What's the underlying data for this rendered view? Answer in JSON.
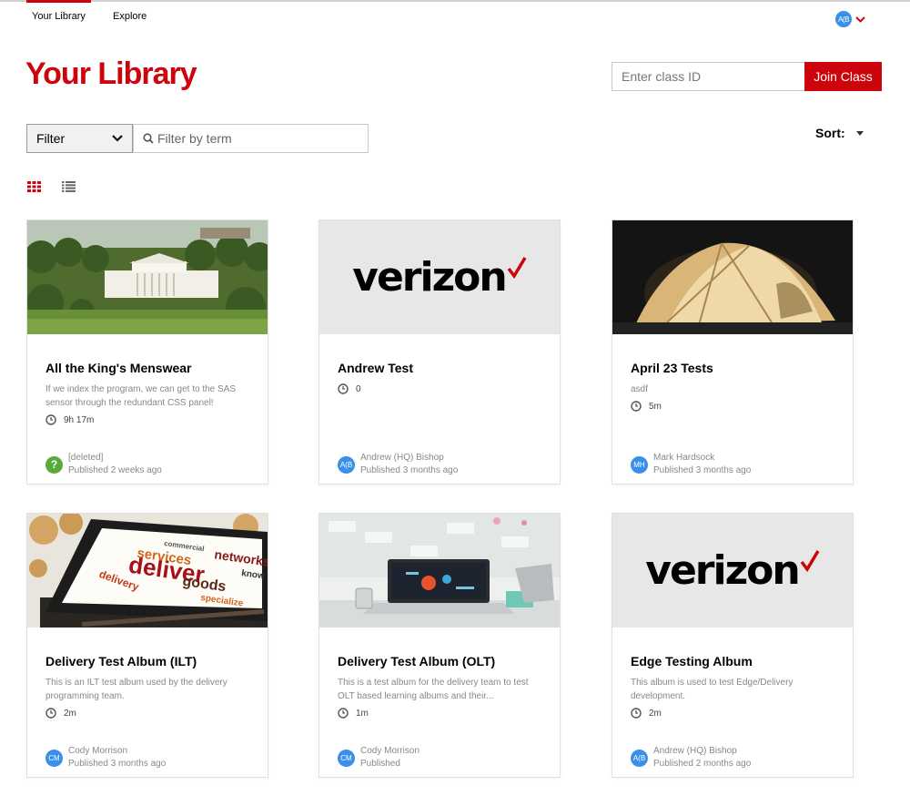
{
  "nav": {
    "tabs": [
      {
        "label": "Your Library",
        "active": true
      },
      {
        "label": "Explore",
        "active": false
      }
    ],
    "user_initials": "A(B"
  },
  "page": {
    "title": "Your Library"
  },
  "join": {
    "placeholder": "Enter class ID",
    "button_label": "Join Class"
  },
  "filter": {
    "select_value": "Filter",
    "term_placeholder": "Filter by term"
  },
  "sort": {
    "label": "Sort:"
  },
  "colors": {
    "brand_red": "#cd040b",
    "avatar_blue": "#3a8fe8",
    "unknown_green": "#5aaa3a"
  },
  "cards": [
    {
      "title": "All the King's Menswear",
      "description": "If we index the program, we can get to the SAS sensor through the redundant CSS panel!",
      "duration": "9h 17m",
      "author": "[deleted]",
      "avatar": "?",
      "published": "Published 2 weeks ago",
      "image": "white-house-photo"
    },
    {
      "title": "Andrew Test",
      "description": "",
      "duration": "0",
      "author": "Andrew (HQ) Bishop",
      "avatar": "A(B",
      "published": "Published 3 months ago",
      "image": "verizon-logo",
      "logo_text": "verizon"
    },
    {
      "title": "April 23 Tests",
      "description": "asdf",
      "duration": "5m",
      "author": "Mark Hardsock",
      "avatar": "MH",
      "published": "Published 3 months ago",
      "image": "tent-photo"
    },
    {
      "title": "Delivery Test Album (ILT)",
      "description": "This is an ILT test album used by the delivery programming team.",
      "duration": "2m",
      "author": "Cody Morrison",
      "avatar": "CM",
      "published": "Published 3 months ago",
      "image": "word-cloud-tablet-photo"
    },
    {
      "title": "Delivery Test Album (OLT)",
      "description": "This is a test album for the delivery team to test OLT based learning albums and their...",
      "duration": "1m",
      "author": "Cody Morrison",
      "avatar": "CM",
      "published": "Published",
      "image": "laptop-desk-photo"
    },
    {
      "title": "Edge Testing Album",
      "description": "This album is used to test Edge/Delivery development.",
      "duration": "2m",
      "author": "Andrew (HQ) Bishop",
      "avatar": "A(B",
      "published": "Published 2 months ago",
      "image": "verizon-logo",
      "logo_text": "verizon"
    }
  ]
}
